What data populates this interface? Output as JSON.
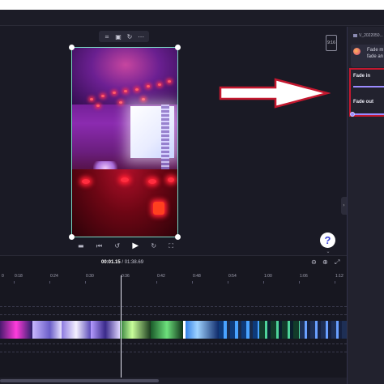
{
  "editor": {
    "title_bar": "",
    "frame_toolbar": [
      "crop-icon",
      "fit-icon",
      "rotate-icon",
      "more-icon"
    ],
    "aspect_ratio": "9:16",
    "playback_icons": [
      "camera-icon",
      "skip-back-icon",
      "rewind-5-icon",
      "play-icon",
      "forward-5-icon",
      "fullscreen-icon"
    ],
    "help_label": "?",
    "collapse_label": "⌄"
  },
  "panel": {
    "file_name": "V_2022050...",
    "card_text_line1": "Fade m",
    "card_text_line2": "fade an",
    "fade_in_label": "Fade in",
    "fade_out_label": "Fade out",
    "fade_in_value": 0,
    "fade_out_value": 0,
    "highlight_color": "#c4182f",
    "slider_color": "#9b8bff"
  },
  "timeline": {
    "current_time": "00:01.15",
    "total_time": "/ 01:38.69",
    "zoom_out": "⊖",
    "zoom_in": "⊕",
    "fit": "⤢",
    "ticks": [
      "0",
      "0:18",
      "0:24",
      "0:30",
      "0:36",
      "0:42",
      "0:48",
      "0:54",
      "1:00",
      "1:06",
      "1:12"
    ]
  },
  "annotation": {
    "arrow": "right-arrow-icon"
  }
}
